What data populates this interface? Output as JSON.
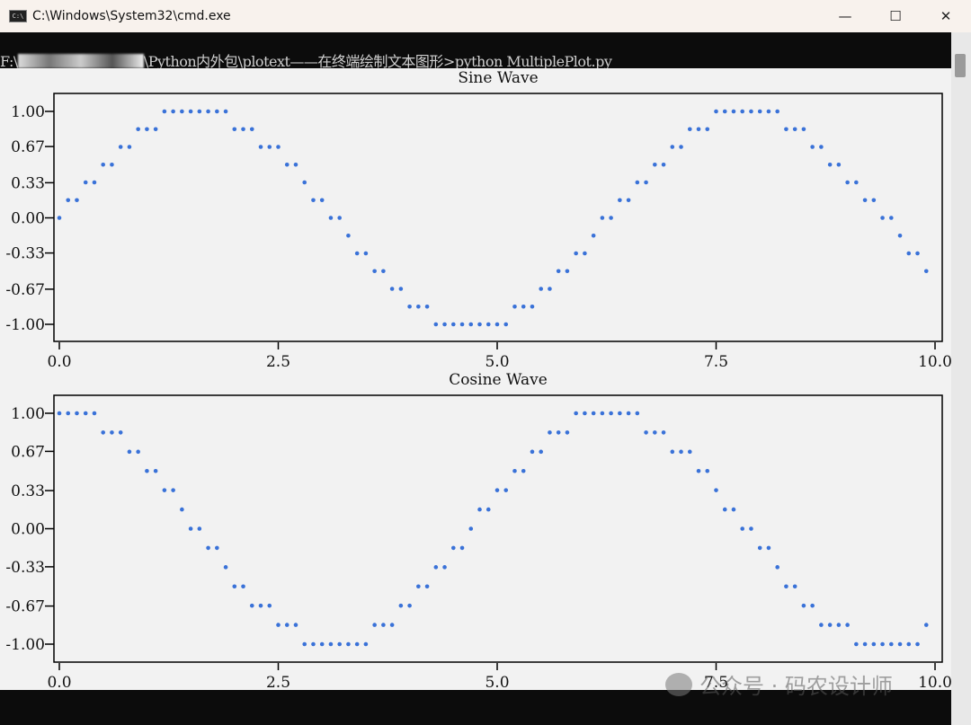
{
  "window": {
    "title": "C:\\Windows\\System32\\cmd.exe",
    "icon": "cmd-icon",
    "controls": {
      "minimize": "—",
      "maximize": "☐",
      "close": "✕"
    }
  },
  "terminal": {
    "prompt_prefix": "F:\\",
    "prompt_suffix": "\\Python内外包\\plotext——在终端绘制文本图形>python MultiplePlot.py"
  },
  "watermark": "公众号 · 码农设计师",
  "colors": {
    "marker": "#3a72d8",
    "axis": "#000000",
    "background": "#f2f2f2"
  },
  "chart_data": [
    {
      "type": "scatter",
      "title": "Sine Wave",
      "xlim": [
        0,
        10
      ],
      "ylim": [
        -1,
        1
      ],
      "xticks": [
        "0.0",
        "2.5",
        "5.0",
        "7.5",
        "10.0"
      ],
      "xtick_values": [
        0,
        2.5,
        5,
        7.5,
        10
      ],
      "yticks": [
        "1.00",
        "0.67",
        "0.33",
        "0.00",
        "-0.33",
        "-0.67",
        "-1.00"
      ],
      "ytick_values": [
        1,
        0.67,
        0.33,
        0,
        -0.33,
        -0.67,
        -1
      ],
      "x_start": 0,
      "x_step": 0.1,
      "y": [
        0.0,
        0.1,
        0.2,
        0.3,
        0.39,
        0.48,
        0.56,
        0.64,
        0.72,
        0.78,
        0.84,
        0.89,
        0.93,
        0.96,
        0.99,
        1.0,
        1.0,
        0.99,
        0.97,
        0.95,
        0.91,
        0.86,
        0.81,
        0.75,
        0.68,
        0.6,
        0.52,
        0.43,
        0.33,
        0.24,
        0.14,
        0.04,
        -0.06,
        -0.16,
        -0.26,
        -0.35,
        -0.44,
        -0.53,
        -0.61,
        -0.69,
        -0.76,
        -0.82,
        -0.87,
        -0.92,
        -0.95,
        -0.98,
        -0.99,
        -1.0,
        -1.0,
        -0.98,
        -0.96,
        -0.93,
        -0.88,
        -0.83,
        -0.77,
        -0.71,
        -0.63,
        -0.55,
        -0.46,
        -0.37,
        -0.28,
        -0.18,
        -0.08,
        0.02,
        0.12,
        0.22,
        0.31,
        0.4,
        0.49,
        0.58,
        0.66,
        0.73,
        0.79,
        0.85,
        0.9,
        0.94,
        0.97,
        0.99,
        1.0,
        1.0,
        0.99,
        0.97,
        0.94,
        0.9,
        0.85,
        0.8,
        0.73,
        0.66,
        0.58,
        0.5,
        0.41,
        0.32,
        0.22,
        0.13,
        0.03,
        -0.08,
        -0.17,
        -0.27,
        -0.37,
        -0.46
      ]
    },
    {
      "type": "scatter",
      "title": "Cosine Wave",
      "xlim": [
        0,
        10
      ],
      "ylim": [
        -1,
        1
      ],
      "xticks": [
        "0.0",
        "2.5",
        "5.0",
        "7.5",
        "10.0"
      ],
      "xtick_values": [
        0,
        2.5,
        5,
        7.5,
        10
      ],
      "yticks": [
        "1.00",
        "0.67",
        "0.33",
        "0.00",
        "-0.33",
        "-0.67",
        "-1.00"
      ],
      "ytick_values": [
        1,
        0.67,
        0.33,
        0,
        -0.33,
        -0.67,
        -1
      ],
      "x_start": 0,
      "x_step": 0.1,
      "y": [
        1.0,
        1.0,
        0.98,
        0.96,
        0.92,
        0.88,
        0.83,
        0.76,
        0.7,
        0.62,
        0.54,
        0.45,
        0.36,
        0.27,
        0.17,
        0.07,
        -0.03,
        -0.13,
        -0.23,
        -0.32,
        -0.42,
        -0.5,
        -0.59,
        -0.67,
        -0.74,
        -0.8,
        -0.86,
        -0.9,
        -0.94,
        -0.97,
        -0.99,
        -1.0,
        -1.0,
        -0.99,
        -0.97,
        -0.94,
        -0.9,
        -0.85,
        -0.79,
        -0.73,
        -0.65,
        -0.57,
        -0.49,
        -0.4,
        -0.31,
        -0.21,
        -0.11,
        -0.01,
        0.09,
        0.19,
        0.28,
        0.38,
        0.47,
        0.55,
        0.63,
        0.71,
        0.78,
        0.83,
        0.89,
        0.93,
        0.96,
        0.98,
        1.0,
        1.0,
        0.99,
        0.98,
        0.95,
        0.91,
        0.87,
        0.82,
        0.75,
        0.68,
        0.61,
        0.53,
        0.44,
        0.35,
        0.25,
        0.15,
        0.05,
        -0.05,
        -0.15,
        -0.24,
        -0.34,
        -0.43,
        -0.52,
        -0.6,
        -0.68,
        -0.75,
        -0.81,
        -0.86,
        -0.91,
        -0.95,
        -0.97,
        -0.99,
        -1.0,
        -1.0,
        -0.98,
        -0.96,
        -0.93,
        -0.89
      ]
    }
  ]
}
